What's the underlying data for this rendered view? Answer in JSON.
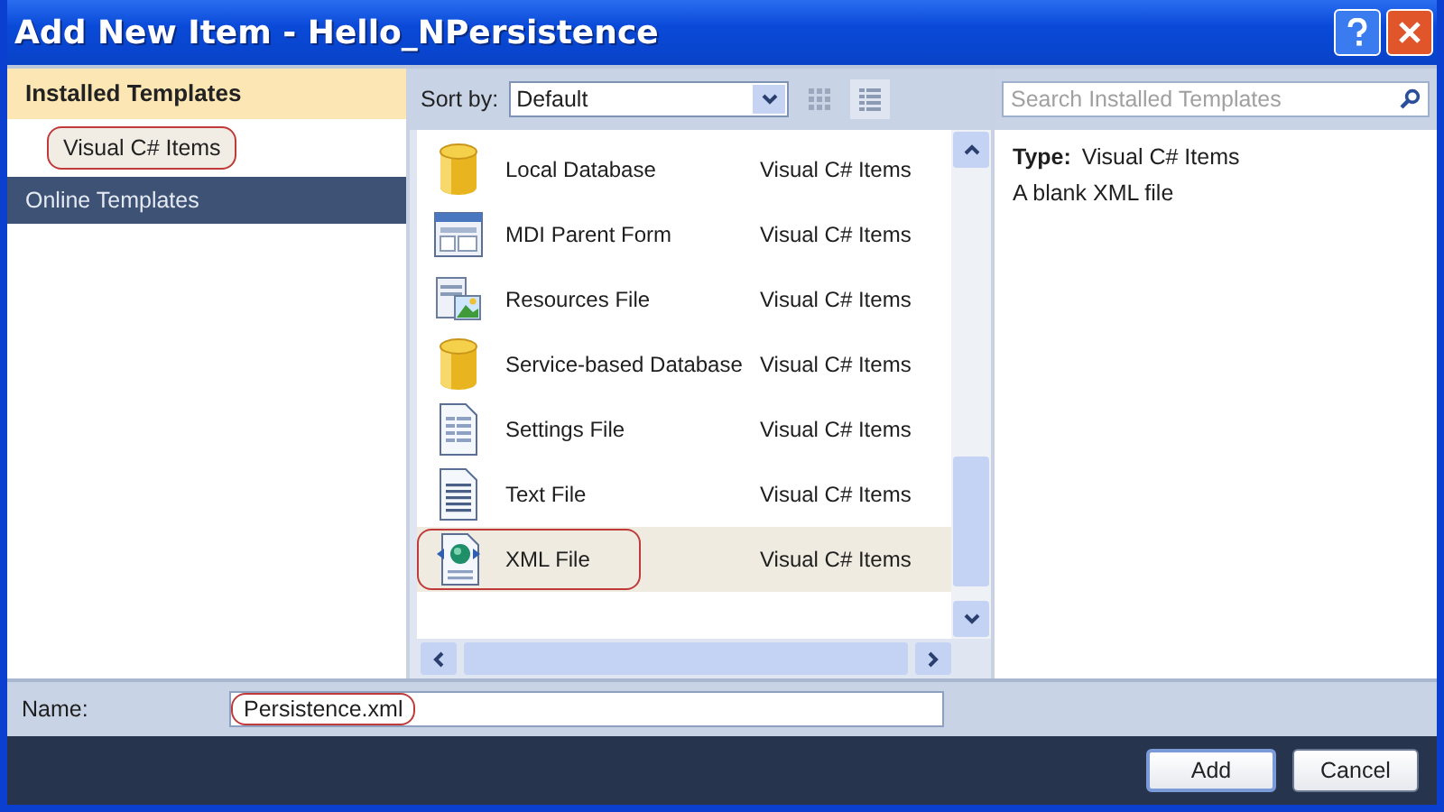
{
  "window": {
    "title": "Add New Item - Hello_NPersistence"
  },
  "sidebar": {
    "items": [
      {
        "label": "Installed Templates",
        "kind": "header",
        "selected": false
      },
      {
        "label": "Visual C# Items",
        "kind": "item",
        "selected": true,
        "circled": true
      },
      {
        "label": "Online Templates",
        "kind": "section",
        "selected": false
      }
    ]
  },
  "toolbar": {
    "sort_label": "Sort by:",
    "sort_value": "Default",
    "search": {
      "placeholder": "Search Installed Templates"
    }
  },
  "templates": [
    {
      "name": "Local Database",
      "category": "Visual C# Items",
      "kind": "database",
      "selected": false,
      "circled": false
    },
    {
      "name": "MDI Parent Form",
      "category": "Visual C# Items",
      "kind": "form",
      "selected": false,
      "circled": false
    },
    {
      "name": "Resources File",
      "category": "Visual C# Items",
      "kind": "resources",
      "selected": false,
      "circled": false
    },
    {
      "name": "Service-based Database",
      "category": "Visual C# Items",
      "kind": "database",
      "selected": false,
      "circled": false
    },
    {
      "name": "Settings File",
      "category": "Visual C# Items",
      "kind": "settings",
      "selected": false,
      "circled": false
    },
    {
      "name": "Text File",
      "category": "Visual C# Items",
      "kind": "text",
      "selected": false,
      "circled": false
    },
    {
      "name": "XML File",
      "category": "Visual C# Items",
      "kind": "xml",
      "selected": true,
      "circled": true
    }
  ],
  "details": {
    "type_label": "Type:",
    "type_value": "Visual C# Items",
    "description": "A blank XML file"
  },
  "name_field": {
    "label": "Name:",
    "value": "Persistence.xml",
    "circled": true
  },
  "buttons": [
    "Add",
    "Cancel"
  ]
}
